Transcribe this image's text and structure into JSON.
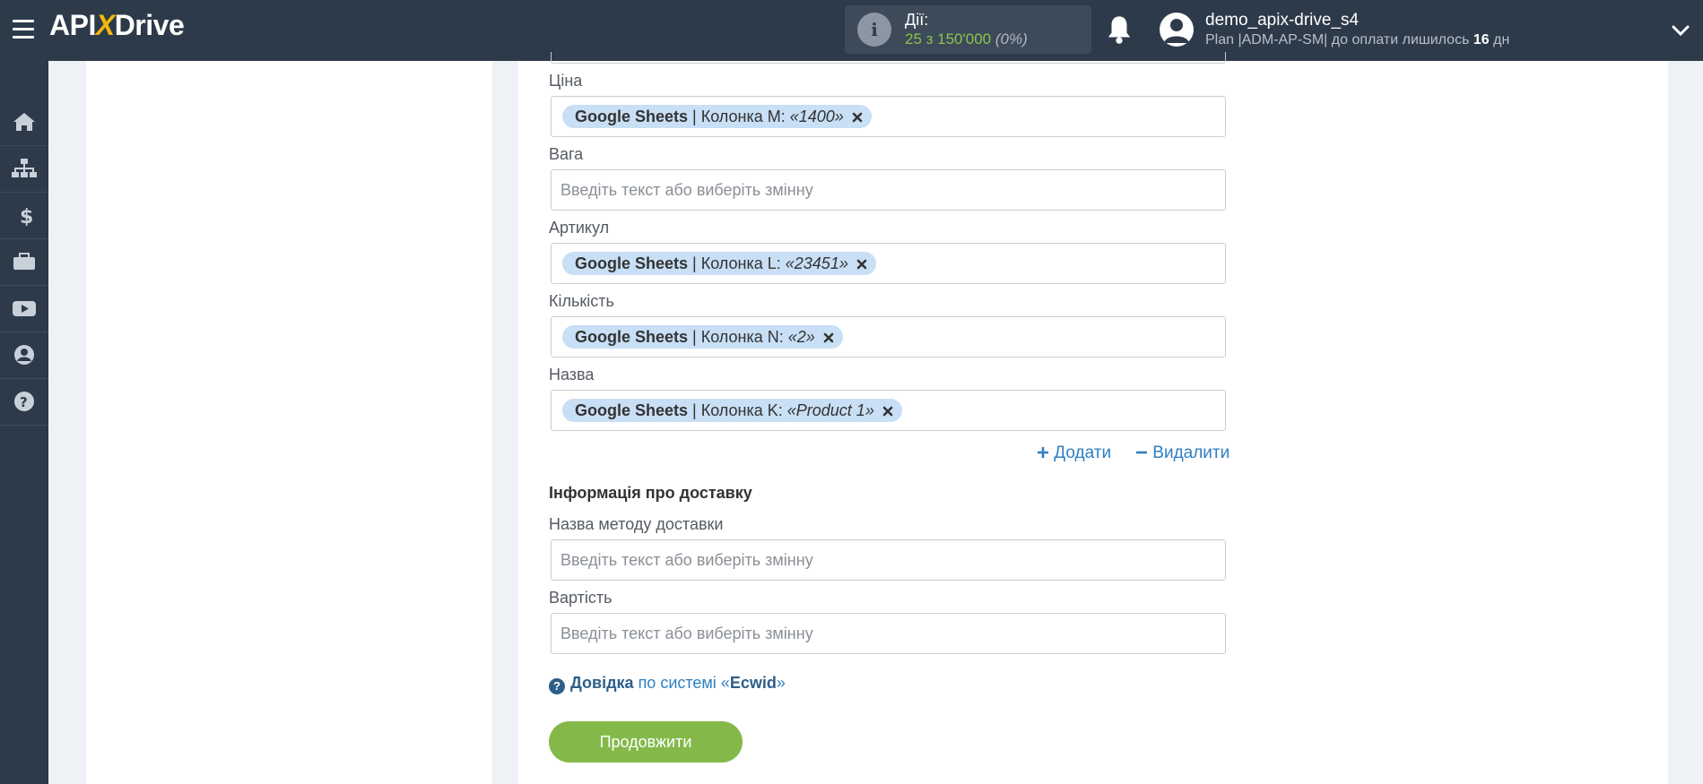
{
  "header": {
    "logo_pre": "API",
    "logo_x": "X",
    "logo_post": "Drive",
    "actions_label": "Дії:",
    "actions_count": "25 з 150'000",
    "actions_pct": "(0%)",
    "user_name": "demo_apix-drive_s4",
    "plan_prefix": "Plan |ADM-AP-SM| до оплати лишилось ",
    "plan_days": "16",
    "plan_suffix": " дн"
  },
  "sidebar": {
    "items": [
      "home-icon",
      "sitemap-icon",
      "dollar-icon",
      "briefcase-icon",
      "youtube-icon",
      "user-icon",
      "question-icon"
    ]
  },
  "form": {
    "fields": [
      {
        "label": "Ціна",
        "tag": {
          "source": "Google Sheets",
          "column": " | Колонка M: ",
          "value": "«1400»"
        }
      },
      {
        "label": "Вага",
        "placeholder": "Введіть текст або виберіть змінну"
      },
      {
        "label": "Артикул",
        "tag": {
          "source": "Google Sheets",
          "column": " | Колонка L: ",
          "value": "«23451»"
        }
      },
      {
        "label": "Кількість",
        "tag": {
          "source": "Google Sheets",
          "column": " | Колонка N: ",
          "value": "«2»"
        }
      },
      {
        "label": "Назва",
        "tag": {
          "source": "Google Sheets",
          "column": " | Колонка K: ",
          "value": "«Product 1»"
        }
      }
    ],
    "add_label": "Додати",
    "remove_label": "Видалити",
    "delivery_title": "Інформація про доставку",
    "delivery_fields": [
      {
        "label": "Назва методу доставки",
        "placeholder": "Введіть текст або виберіть змінну"
      },
      {
        "label": "Вартість",
        "placeholder": "Введіть текст або виберіть змінну"
      }
    ],
    "help_link": "Довідка",
    "help_mid": " по системі «",
    "help_system": "Ecwid",
    "help_end": "»",
    "continue_label": "Продовжити"
  },
  "colors": {
    "topbar": "#2d3a4a",
    "accent_green": "#84b94a",
    "tag_bg": "#c8dff5",
    "link_blue": "#2f7fc1"
  }
}
